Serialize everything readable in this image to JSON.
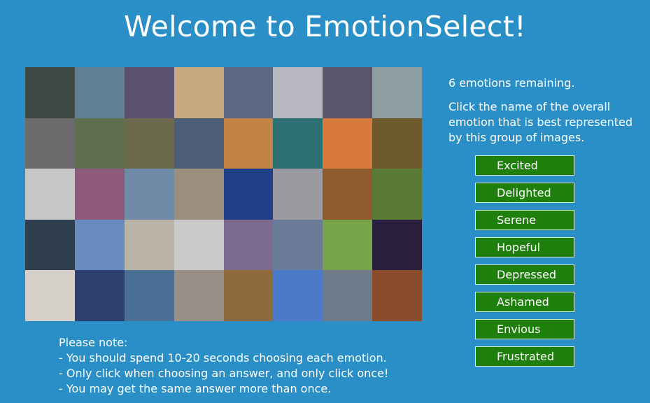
{
  "header": {
    "title": "Welcome to EmotionSelect!"
  },
  "status": {
    "remaining": "6 emotions remaining."
  },
  "instructions": "Click the name of the overall emotion that is best represented by this group of images.",
  "choices": [
    "Excited",
    "Delighted",
    "Serene",
    "Hopeful",
    "Depressed",
    "Ashamed",
    "Envious",
    "Frustrated"
  ],
  "note": {
    "heading": "Please note:",
    "lines": [
      "- You should spend 10-20 seconds choosing each emotion.",
      "- Only click when choosing an answer, and only click once!",
      "- You may get the same answer more than once."
    ]
  },
  "colors": {
    "background": "#2a8fc6",
    "button": "#1e7f0c",
    "button_border": "#d8efd2"
  },
  "image_grid": {
    "rows": 5,
    "columns": 8,
    "images": [
      "lake-pier-person-photo",
      "lake-boats-photo",
      "mountain-lake-sunset-photo",
      "boat-on-dock-photo",
      "lake-dusk-photo",
      "calm-lake-photo",
      "rowboats-photo",
      "misty-lake-photo",
      "smiling-woman-photo",
      "tree-lined-road-photo",
      "forest-path-photo",
      "island-dock-photo",
      "sunset-dock-photo",
      "tall-pole-lake-photo",
      "orange-sunset-lake-photo",
      "trees-pond-photo",
      "grey-sea-photo",
      "pink-sunset-sea-photo",
      "cloudy-lake-photo",
      "rocky-shore-photo",
      "blue-railing-photo",
      "white-cloth-photo",
      "orange-sky-lake-photo",
      "swans-photo",
      "red-mountains-lake-photo",
      "blue-sky-clouds-photo",
      "marina-boats-photo",
      "red-flower-snow-photo",
      "pink-sky-photo",
      "lake-swimmer-photo",
      "green-field-photo",
      "glowing-cross-photo",
      "red-flowers-photo",
      "dark-sunset-photo",
      "blue-water-reeds-photo",
      "rocky-beach-photo",
      "harbor-boats-photo",
      "blue-sky-photo",
      "tree-silhouette-lake-photo",
      "orange-horizon-photo"
    ],
    "colors": [
      [
        "#3d4a44",
        "#5e7f96",
        "#5a5070",
        "#c9a981",
        "#5b6a82",
        "#b7b8bf",
        "#59556a",
        "#8f9ea3"
      ],
      [
        "#6b6b6b",
        "#5f6f4f",
        "#6b6a4c",
        "#4c5f77",
        "#c28346",
        "#2f7077",
        "#d87a3c",
        "#6e5a2a"
      ],
      [
        "#c6c6c6",
        "#8d5a7c",
        "#6e8aa6",
        "#9a8f7c",
        "#1f3f8a",
        "#9a9aa0",
        "#8f5a2c",
        "#5a7a38"
      ],
      [
        "#2f3f4f",
        "#6a8bbf",
        "#b8b3a6",
        "#c9c9cc",
        "#7d6a8f",
        "#6b7b9a",
        "#78a54c",
        "#2a1e3f"
      ],
      [
        "#d5d0c9",
        "#2c3f6e",
        "#4c6f96",
        "#9a8f86",
        "#8f6a3f",
        "#4c7acb",
        "#6f7a8a",
        "#8a4c2a"
      ]
    ]
  }
}
